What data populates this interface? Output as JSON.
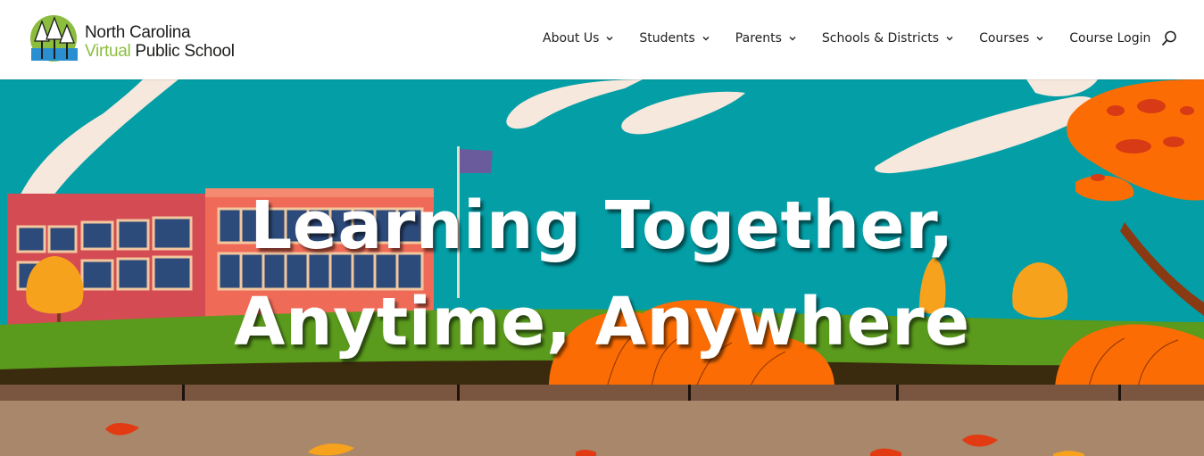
{
  "brand": {
    "line1": "North Carolina",
    "line2_accent": "Virtual",
    "line2_rest": " Public School",
    "accent_color": "#8cbd3f"
  },
  "nav": {
    "items": [
      {
        "label": "About Us",
        "has_dropdown": true
      },
      {
        "label": "Students",
        "has_dropdown": true
      },
      {
        "label": "Parents",
        "has_dropdown": true
      },
      {
        "label": "Schools & Districts",
        "has_dropdown": true
      },
      {
        "label": "Courses",
        "has_dropdown": true
      },
      {
        "label": "Course Login",
        "has_dropdown": false
      }
    ],
    "search_icon": "search-icon"
  },
  "hero": {
    "title_line1": "Learning Together,",
    "title_line2": "Anytime, Anywhere",
    "sky_color": "#049ea6",
    "grass_color": "#5a9a1c",
    "path_color": "#a9876a",
    "tree_color": "#fb6d04"
  }
}
